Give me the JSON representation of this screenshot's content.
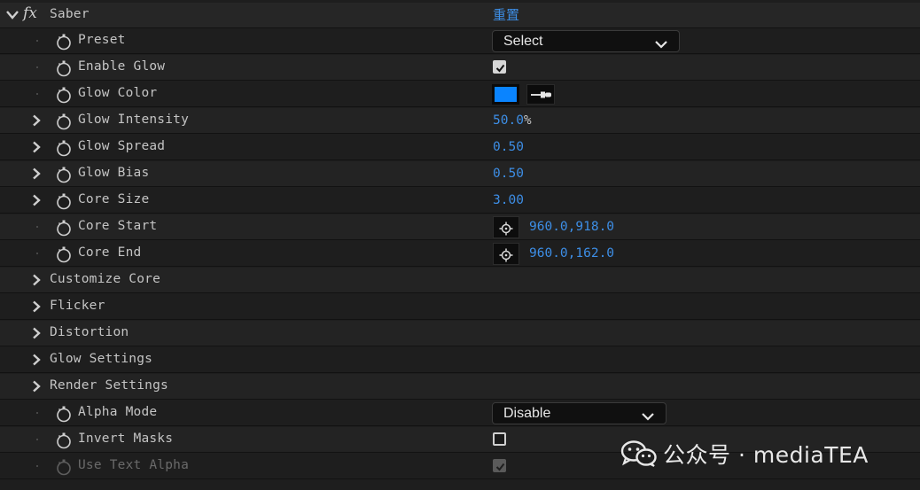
{
  "effect": {
    "name": "Saber",
    "fx_label": "fx",
    "reset_label": "重置"
  },
  "properties": {
    "preset": {
      "label": "Preset",
      "value": "Select"
    },
    "enable_glow": {
      "label": "Enable Glow",
      "checked": true
    },
    "glow_color": {
      "label": "Glow Color",
      "color": "#0a84ff"
    },
    "glow_intensity": {
      "label": "Glow Intensity",
      "value": "50.0",
      "unit": "%"
    },
    "glow_spread": {
      "label": "Glow Spread",
      "value": "0.50"
    },
    "glow_bias": {
      "label": "Glow Bias",
      "value": "0.50"
    },
    "core_size": {
      "label": "Core Size",
      "value": "3.00"
    },
    "core_start": {
      "label": "Core Start",
      "value": "960.0,918.0"
    },
    "core_end": {
      "label": "Core End",
      "value": "960.0,162.0"
    }
  },
  "groups": {
    "customize_core": "Customize Core",
    "flicker": "Flicker",
    "distortion": "Distortion",
    "glow_settings": "Glow Settings",
    "render_settings": "Render Settings"
  },
  "render_props": {
    "alpha_mode": {
      "label": "Alpha Mode",
      "value": "Disable"
    },
    "invert_masks": {
      "label": "Invert Masks",
      "checked": false
    },
    "use_text_alpha": {
      "label": "Use Text Alpha",
      "checked": true,
      "disabled": true
    }
  },
  "watermark": {
    "text": "公众号 · mediaTEA"
  },
  "icons": {
    "twirl_open": "chevron-down-icon",
    "twirl_closed": "chevron-right-icon",
    "stopwatch": "stopwatch-icon",
    "eyedropper": "eyedropper-icon",
    "crosshair": "crosshair-icon",
    "wechat": "wechat-icon"
  },
  "colors": {
    "value_blue": "#3d8ee6",
    "panel_bg": "#1e1e1e"
  }
}
